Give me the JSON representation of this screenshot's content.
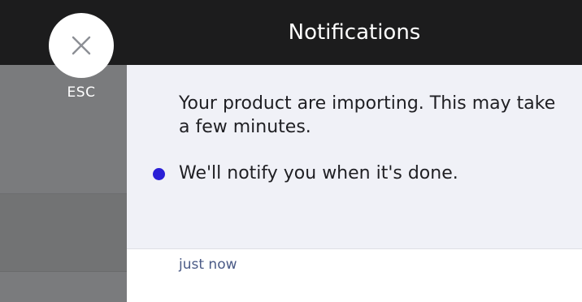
{
  "overlay": {
    "close_icon": "close-icon",
    "esc_label": "ESC"
  },
  "panel": {
    "title": "Notifications",
    "notifications": [
      {
        "unread": true,
        "message_line1": "Your product are importing. This may take a few minutes.",
        "message_line2": "We'll notify you when it's done.",
        "time": "just now"
      }
    ]
  },
  "colors": {
    "header_bg": "#1c1c1d",
    "notification_bg": "#f0f1f7",
    "unread_dot": "#2a1fd6",
    "timestamp": "#4a5a86"
  }
}
